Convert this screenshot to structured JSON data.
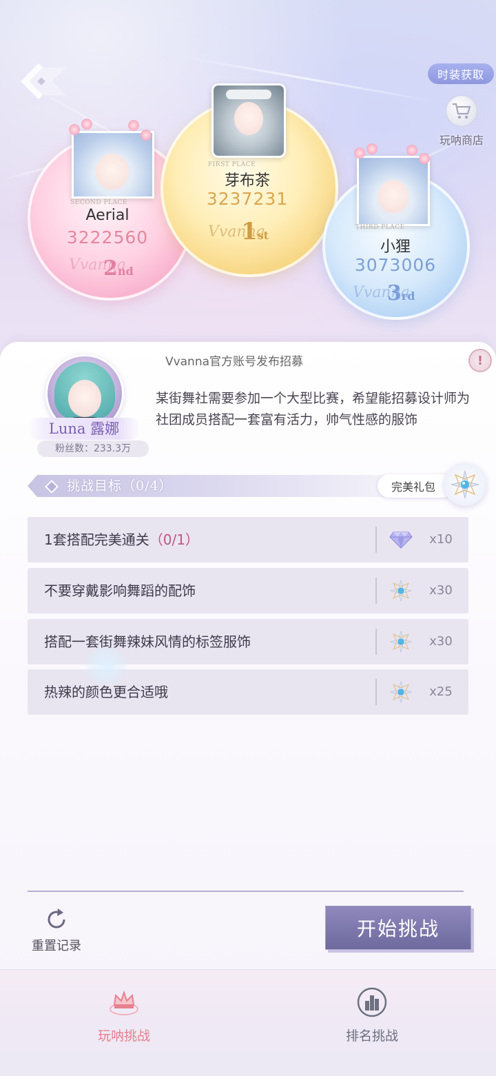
{
  "header": {
    "time_button": "时装获取",
    "shop_label": "玩呐商店"
  },
  "podium": {
    "first": {
      "place": "FIRST PLACE",
      "name": "芽布茶",
      "score": "3237231",
      "script": "Vvanna",
      "rank": "1",
      "rank_suffix": "st"
    },
    "second": {
      "place": "SECOND PLACE",
      "name": "Aerial",
      "score": "3222560",
      "script": "Vvanna",
      "rank": "2",
      "rank_suffix": "nd"
    },
    "third": {
      "place": "THIRD PLACE",
      "name": "小狸",
      "score": "3073006",
      "script": "Vvanna",
      "rank": "3",
      "rank_suffix": "rd"
    }
  },
  "recruit": {
    "title": "Vvanna官方账号发布招募",
    "alert": "!",
    "npc_name": "Luna 露娜",
    "fans": "粉丝数：233.3万",
    "description": "某街舞社需要参加一个大型比赛，希望能招募设计师为社团成员搭配一套富有活力，帅气性感的服饰"
  },
  "goals": {
    "title": "挑战目标（0/4）",
    "gift_label": "完美礼包",
    "tasks": [
      {
        "text": "1套搭配完美通关",
        "progress": "（0/1）",
        "reward_icon": "diamond-icon",
        "count": "x10"
      },
      {
        "text": "不要穿戴影响舞蹈的配饰",
        "progress": "",
        "reward_icon": "star-gem-icon",
        "count": "x30"
      },
      {
        "text": "搭配一套街舞辣妹风情的标签服饰",
        "progress": "",
        "reward_icon": "star-gem-icon",
        "count": "x30"
      },
      {
        "text": "热辣的颜色更合适哦",
        "progress": "",
        "reward_icon": "star-gem-icon",
        "count": "x25"
      }
    ]
  },
  "actions": {
    "reset_label": "重置记录",
    "start_label": "开始挑战"
  },
  "nav": {
    "items": [
      {
        "label": "玩呐挑战",
        "active": true
      },
      {
        "label": "排名挑战",
        "active": false
      }
    ]
  },
  "colors": {
    "accent_pink": "#e7808f",
    "nav_inactive": "#6d7080",
    "gold": "#d9a64e",
    "pink_score": "#e6869f",
    "blue_score": "#7c9fd6"
  }
}
